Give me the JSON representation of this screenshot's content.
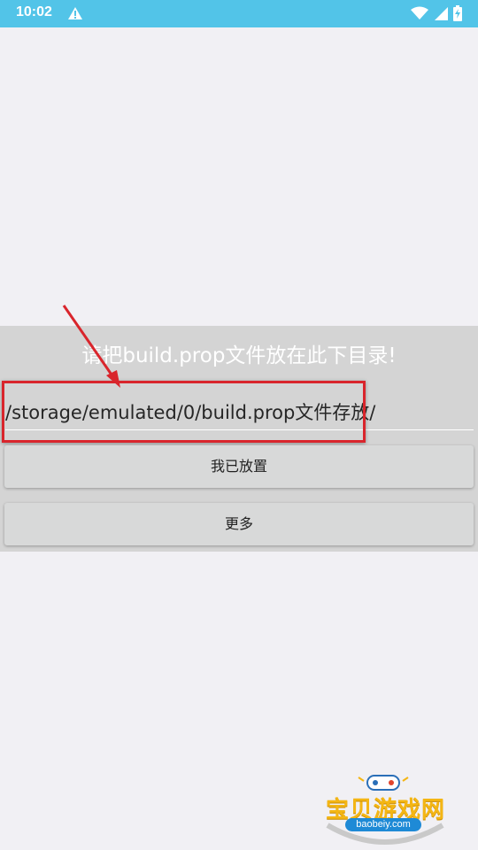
{
  "status_bar": {
    "time": "10:02",
    "icons": [
      "alert-icon",
      "wifi-icon",
      "signal-icon",
      "battery-icon"
    ]
  },
  "dialog": {
    "instruction": "请把build.prop文件放在此下目录!",
    "path_value": "/storage/emulated/0/build.prop文件存放/",
    "button_placed": "我已放置",
    "button_more": "更多"
  },
  "watermark": {
    "title": "宝贝游戏网",
    "url": "baobeiy.com"
  },
  "colors": {
    "status_bar": "#52c4e8",
    "background": "#f1f0f4",
    "panel": "#d4d4d4",
    "highlight": "#d9252c",
    "button": "#d8d9d9"
  }
}
